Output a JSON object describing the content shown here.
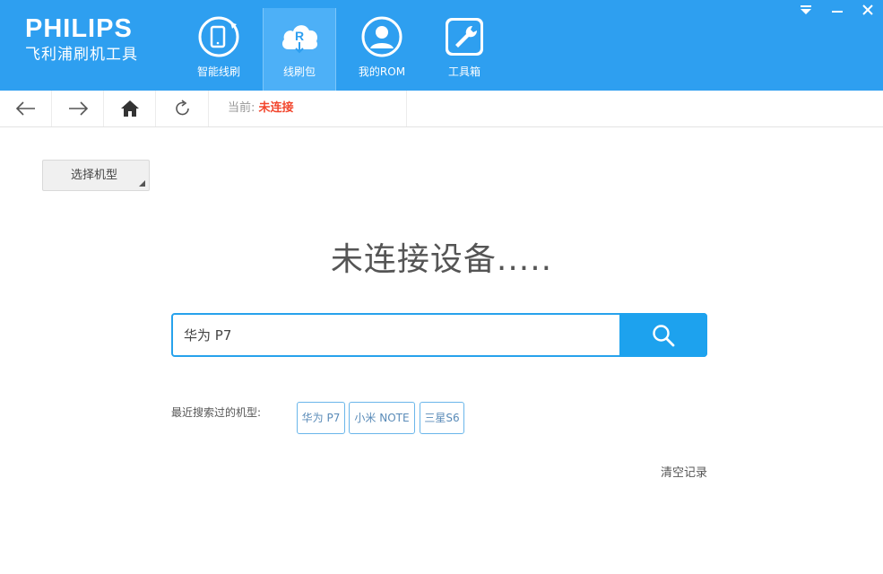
{
  "brand": {
    "name": "PHILIPS",
    "subtitle": "飞利浦刷机工具"
  },
  "nav": [
    {
      "label": "智能线刷",
      "icon": "phone-refresh-icon"
    },
    {
      "label": "线刷包",
      "icon": "cloud-download-icon",
      "active": true
    },
    {
      "label": "我的ROM",
      "icon": "user-icon"
    },
    {
      "label": "工具箱",
      "icon": "wrench-icon"
    }
  ],
  "window_controls": [
    "dropdown-menu-icon",
    "minimize-icon",
    "close-icon"
  ],
  "toolbar": {
    "status_prefix": "当前:",
    "status_value": "未连接"
  },
  "model_select": {
    "label": "选择机型"
  },
  "main": {
    "title": "未连接设备....."
  },
  "search": {
    "value": "华为 P7"
  },
  "recent": {
    "label": "最近搜索过的机型:",
    "items": [
      "华为 P7",
      "小米 NOTE",
      "三星S6"
    ]
  },
  "clear_label": "清空记录",
  "colors": {
    "header": "#2e9ff0",
    "accent": "#1da2ee",
    "status_red": "#f2462d"
  }
}
